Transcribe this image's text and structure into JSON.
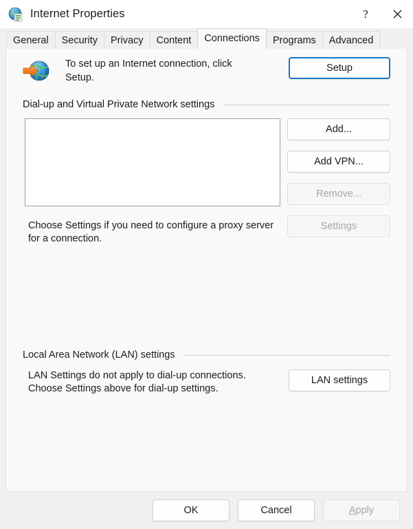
{
  "window": {
    "title": "Internet Properties",
    "icon": "internet-properties-icon",
    "caption_buttons": [
      {
        "name": "help-button",
        "glyph": "?"
      },
      {
        "name": "close-button",
        "glyph": "✕"
      }
    ]
  },
  "tabs": [
    {
      "label": "General",
      "active": false
    },
    {
      "label": "Security",
      "active": false
    },
    {
      "label": "Privacy",
      "active": false
    },
    {
      "label": "Content",
      "active": false
    },
    {
      "label": "Connections",
      "active": true
    },
    {
      "label": "Programs",
      "active": false
    },
    {
      "label": "Advanced",
      "active": false
    }
  ],
  "setup": {
    "description": "To set up an Internet connection, click Setup.",
    "button_label": "Setup",
    "icon": "globe-with-arrow-icon"
  },
  "dialup": {
    "group_label": "Dial-up and Virtual Private Network settings",
    "list_items": [],
    "proxy_note": "Choose Settings if you need to configure a proxy server for a connection.",
    "buttons": [
      {
        "label": "Add...",
        "name": "add-button",
        "disabled": false
      },
      {
        "label": "Add VPN...",
        "name": "add-vpn-button",
        "disabled": false
      },
      {
        "label": "Remove...",
        "name": "remove-button",
        "disabled": true
      },
      {
        "label": "Settings",
        "name": "settings-button",
        "disabled": true
      }
    ]
  },
  "lan": {
    "group_label": "Local Area Network (LAN) settings",
    "note": "LAN Settings do not apply to dial-up connections. Choose Settings above for dial-up settings.",
    "button_label": "LAN settings"
  },
  "footer": {
    "ok_label": "OK",
    "cancel_label": "Cancel",
    "apply_label_prefix": "A",
    "apply_label_rest": "pply",
    "apply_disabled": true
  },
  "colors": {
    "accent": "#1a73c8",
    "window_bg": "#f0f0f0",
    "content_bg": "#f9f9f9",
    "text": "#1b1b1b",
    "disabled_text": "#a6a6a6"
  }
}
